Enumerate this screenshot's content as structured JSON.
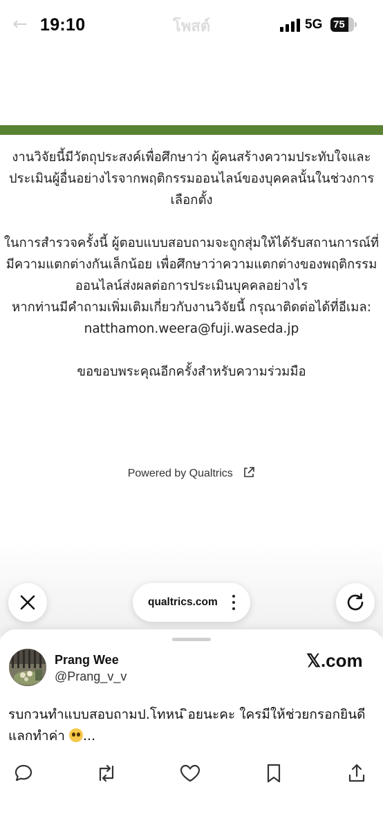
{
  "status_bar": {
    "time": "19:10",
    "network": "5G",
    "battery_level": "75",
    "battery_fraction": 0.75,
    "signal_bars": 4,
    "ghost_back": "←",
    "ghost_title": "โพสต์"
  },
  "accent_color": "#5a8233",
  "survey": {
    "paragraph_1": "งานวิจัยนี้มีวัตถุประสงค์เพื่อศึกษาว่า ผู้คนสร้างความประทับใจและประเมินผู้อื่นอย่างไรจากพฤติกรรมออนไลน์ของบุคคลนั้นในช่วงการเลือกตั้ง",
    "paragraph_2": "ในการสำรวจครั้งนี้ ผู้ตอบแบบสอบถามจะถูกสุ่มให้ได้รับสถานการณ์ที่มีความแตกต่างกันเล็กน้อย เพื่อศึกษาว่าความแตกต่างของพฤติกรรมออนไลน์ส่งผลต่อการประเมินบุคคลอย่างไร",
    "paragraph_3": "หากท่านมีคำถามเพิ่มเติมเกี่ยวกับงานวิจัยนี้ กรุณาติดต่อได้ที่อีเมล: natthamon.weera@fuji.waseda.jp",
    "thanks": "ขอขอบพระคุณอีกครั้งสำหรับความร่วมมือ",
    "powered_by": "Powered by Qualtrics"
  },
  "browser": {
    "url": "qualtrics.com",
    "close_icon": "close-icon",
    "reload_icon": "reload-icon",
    "more_icon": "vertical-dots-icon"
  },
  "tweet": {
    "name": "Prang Wee",
    "handle": "@Prang_v_v",
    "site": "𝕏.com",
    "text": "รบกวนทำแบบสอบถามป.โทหน่ ิอยนะคะ ใครมีให้ช่วยกรอกยินดีแลกทำค่า",
    "ellipsis": "...",
    "actions": [
      "reply-icon",
      "repost-icon",
      "like-icon",
      "bookmark-icon",
      "share-icon"
    ]
  }
}
